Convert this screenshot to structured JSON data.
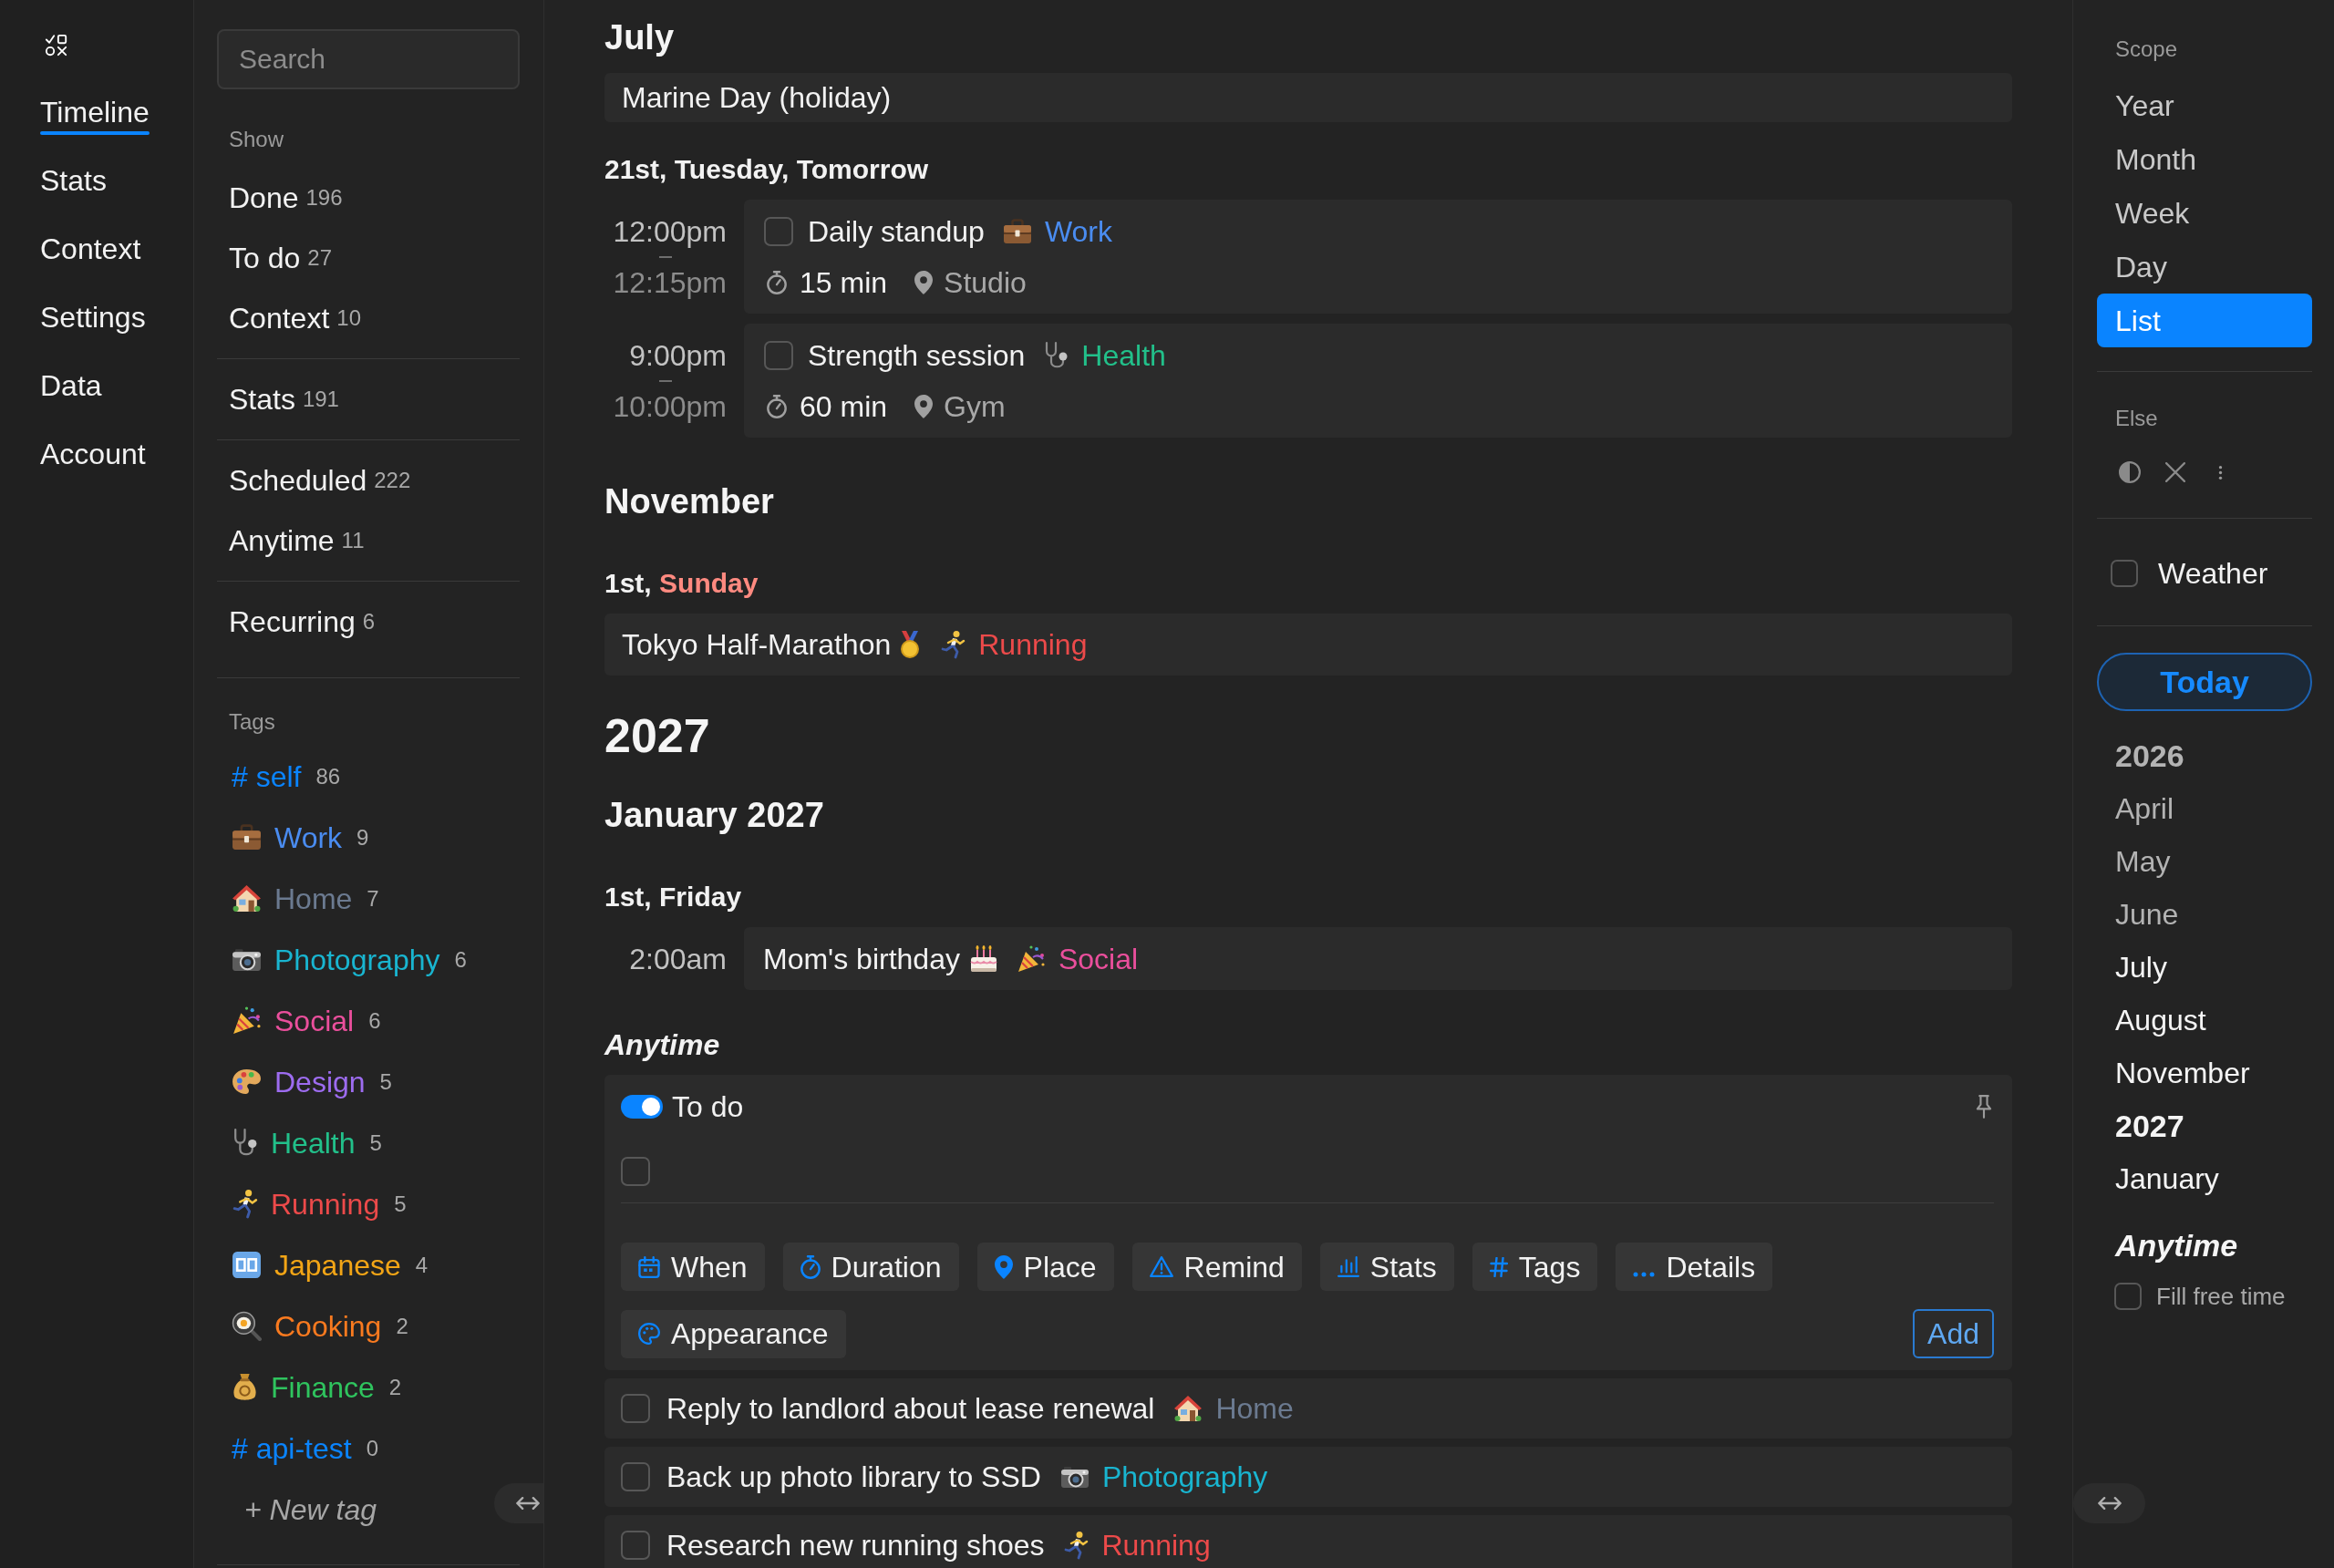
{
  "nav": {
    "items": [
      {
        "label": "Timeline",
        "selected": true
      },
      {
        "label": "Stats",
        "selected": false
      },
      {
        "label": "Context",
        "selected": false
      },
      {
        "label": "Settings",
        "selected": false
      },
      {
        "label": "Data",
        "selected": false
      },
      {
        "label": "Account",
        "selected": false
      }
    ]
  },
  "sidebar": {
    "search": {
      "placeholder": "Search"
    },
    "show_heading": "Show",
    "show_groups": [
      {
        "items": [
          {
            "label": "Done",
            "count": "196"
          },
          {
            "label": "To do",
            "count": "27"
          },
          {
            "label": "Context",
            "count": "10"
          }
        ]
      },
      {
        "items": [
          {
            "label": "Stats",
            "count": "191"
          }
        ]
      },
      {
        "items": [
          {
            "label": "Scheduled",
            "count": "222"
          },
          {
            "label": "Anytime",
            "count": "11"
          }
        ]
      },
      {
        "items": [
          {
            "label": "Recurring",
            "count": "6"
          }
        ]
      }
    ],
    "tags_heading": "Tags",
    "tags": [
      {
        "kind": "hash",
        "symbol": "#",
        "label": "self",
        "count": "86",
        "color": "#0a84ff"
      },
      {
        "kind": "briefcase",
        "label": "Work",
        "count": "9",
        "color": "#4a8cf0"
      },
      {
        "kind": "house",
        "label": "Home",
        "count": "7",
        "color": "#6b7a90"
      },
      {
        "kind": "camera",
        "label": "Photography",
        "count": "6",
        "color": "#19b5d0"
      },
      {
        "kind": "party",
        "label": "Social",
        "count": "6",
        "color": "#ea4f9c"
      },
      {
        "kind": "palette",
        "label": "Design",
        "count": "5",
        "color": "#9d6cf0"
      },
      {
        "kind": "stethoscope",
        "label": "Health",
        "count": "5",
        "color": "#22c08a"
      },
      {
        "kind": "runner",
        "label": "Running",
        "count": "5",
        "color": "#ec4a4a"
      },
      {
        "kind": "tile",
        "label": "Japanese",
        "count": "4",
        "color": "#f2a516"
      },
      {
        "kind": "pan",
        "label": "Cooking",
        "count": "2",
        "color": "#f97a1f"
      },
      {
        "kind": "moneybag",
        "label": "Finance",
        "count": "2",
        "color": "#2fc45e"
      },
      {
        "kind": "hash",
        "symbol": "#",
        "label": "api-test",
        "count": "0",
        "color": "#0a84ff"
      }
    ],
    "new_tag": "+ New tag"
  },
  "timeline": {
    "blocks": [
      {
        "kind": "month",
        "title": "July"
      },
      {
        "kind": "holiday",
        "title": "Marine Day (holiday)"
      },
      {
        "kind": "day",
        "date": "21st,",
        "weekday": "Tuesday, Tomorrow",
        "weekend": false
      },
      {
        "kind": "event",
        "start": "12:00pm",
        "end": "12:15pm",
        "checked": false,
        "title": "Daily standup",
        "tag": {
          "kind": "briefcase",
          "label": "Work",
          "color": "#4a8cf0"
        },
        "duration": "15 min",
        "place": "Studio"
      },
      {
        "kind": "event",
        "start": "9:00pm",
        "end": "10:00pm",
        "checked": false,
        "title": "Strength session",
        "tag": {
          "kind": "stethoscope",
          "label": "Health",
          "color": "#22c08a"
        },
        "duration": "60 min",
        "place": "Gym"
      },
      {
        "kind": "month",
        "title": "November"
      },
      {
        "kind": "day",
        "date": "1st,",
        "weekday": "Sunday",
        "weekend": true
      },
      {
        "kind": "allday",
        "title": "Tokyo Half-Marathon",
        "emoji": {
          "kind": "medal"
        },
        "tag": {
          "kind": "runner",
          "label": "Running",
          "color": "#ec4a4a"
        }
      },
      {
        "kind": "year",
        "title": "2027"
      },
      {
        "kind": "month",
        "title": "January 2027"
      },
      {
        "kind": "day",
        "date": "1st,",
        "weekday": "Friday",
        "weekend": false
      },
      {
        "kind": "event",
        "start": "2:00am",
        "title": "Mom's birthday",
        "emoji": {
          "kind": "cake"
        },
        "tag": {
          "kind": "party",
          "label": "Social",
          "color": "#ea4f9c"
        }
      },
      {
        "kind": "anytime",
        "title": "Anytime"
      },
      {
        "kind": "composer",
        "toggle": {
          "label": "To do",
          "on": true
        },
        "checked": false,
        "buttons": [
          {
            "kind": "calendar",
            "label": "When"
          },
          {
            "kind": "stopwatch",
            "label": "Duration"
          },
          {
            "kind": "pin",
            "label": "Place"
          },
          {
            "kind": "warning",
            "label": "Remind"
          },
          {
            "kind": "chart",
            "label": "Stats"
          },
          {
            "kind": "hash",
            "label": "Tags"
          },
          {
            "kind": "dots",
            "label": "Details"
          },
          {
            "kind": "palette",
            "label": "Appearance"
          }
        ],
        "add": "Add"
      },
      {
        "kind": "task",
        "checked": false,
        "title": "Reply to landlord about lease renewal",
        "tag": {
          "kind": "house",
          "label": "Home",
          "color": "#6b7a90"
        }
      },
      {
        "kind": "task",
        "checked": false,
        "title": "Back up photo library to SSD",
        "tag": {
          "kind": "camera",
          "label": "Photography",
          "color": "#19b5d0"
        }
      },
      {
        "kind": "task",
        "checked": false,
        "title": "Research new running shoes",
        "tag": {
          "kind": "runner",
          "label": "Running",
          "color": "#ec4a4a"
        }
      }
    ]
  },
  "scope_panel": {
    "heading": "Scope",
    "options": [
      {
        "label": "Year",
        "selected": false
      },
      {
        "label": "Month",
        "selected": false
      },
      {
        "label": "Week",
        "selected": false
      },
      {
        "label": "Day",
        "selected": false
      },
      {
        "label": "List",
        "selected": true
      }
    ],
    "else_heading": "Else",
    "weather": {
      "label": "Weather",
      "checked": false
    },
    "today": "Today",
    "jump_list": [
      {
        "kind": "year",
        "label": "2026",
        "dimmed": true
      },
      {
        "kind": "month",
        "label": "April",
        "dimmed": true
      },
      {
        "kind": "month",
        "label": "May",
        "dimmed": true
      },
      {
        "kind": "month",
        "label": "June",
        "dimmed": true
      },
      {
        "kind": "month",
        "label": "July",
        "dimmed": false
      },
      {
        "kind": "month",
        "label": "August",
        "dimmed": false
      },
      {
        "kind": "month",
        "label": "November",
        "dimmed": false
      },
      {
        "kind": "year",
        "label": "2027",
        "dimmed": false
      },
      {
        "kind": "month",
        "label": "January",
        "dimmed": false
      },
      {
        "kind": "anytime",
        "label": "Anytime",
        "dimmed": false
      }
    ],
    "fill_free_time": {
      "label": "Fill free time",
      "checked": false
    }
  }
}
